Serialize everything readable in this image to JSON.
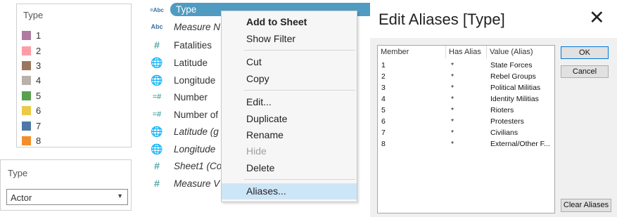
{
  "legend": {
    "title": "Type",
    "items": [
      {
        "label": "1",
        "color": "#b07aa1"
      },
      {
        "label": "2",
        "color": "#ff9da7"
      },
      {
        "label": "3",
        "color": "#9c755f"
      },
      {
        "label": "4",
        "color": "#bab0ac"
      },
      {
        "label": "5",
        "color": "#59a14f"
      },
      {
        "label": "6",
        "color": "#edc948"
      },
      {
        "label": "7",
        "color": "#4e79a7"
      },
      {
        "label": "8",
        "color": "#f28e2b"
      }
    ]
  },
  "filter": {
    "title": "Type",
    "selected": "Actor"
  },
  "data_pane": {
    "selected_field": {
      "icon": "=Abc",
      "name": "Type"
    },
    "fields": [
      {
        "icon": "Abc",
        "name": "Measure N",
        "italic": true
      },
      {
        "icon": "#",
        "name": "Fatalities",
        "italic": false
      },
      {
        "icon": "globe",
        "name": "Latitude",
        "italic": false
      },
      {
        "icon": "globe",
        "name": "Longitude",
        "italic": false
      },
      {
        "icon": "=#",
        "name": "Number",
        "italic": false
      },
      {
        "icon": "=#",
        "name": "Number of",
        "italic": false
      },
      {
        "icon": "globe",
        "name": "Latitude (g",
        "italic": true
      },
      {
        "icon": "globe",
        "name": "Longitude",
        "italic": true
      },
      {
        "icon": "#",
        "name": "Sheet1 (Co",
        "italic": true
      },
      {
        "icon": "#",
        "name": "Measure V",
        "italic": true
      }
    ]
  },
  "context_menu": {
    "items": [
      {
        "label": "Add to Sheet",
        "bold": true
      },
      {
        "label": "Show Filter"
      },
      {
        "label": "Cut"
      },
      {
        "label": "Copy"
      },
      {
        "label": "Edit..."
      },
      {
        "label": "Duplicate"
      },
      {
        "label": "Rename"
      },
      {
        "label": "Hide",
        "disabled": true
      },
      {
        "label": "Delete"
      },
      {
        "label": "Aliases...",
        "highlighted": true
      }
    ]
  },
  "dialog": {
    "title": "Edit Aliases [Type]",
    "close_symbol": "✕",
    "columns": [
      "Member",
      "Has Alias",
      "Value (Alias)"
    ],
    "rows": [
      {
        "member": "1",
        "has_alias": "*",
        "value": "State Forces"
      },
      {
        "member": "2",
        "has_alias": "*",
        "value": "Rebel Groups"
      },
      {
        "member": "3",
        "has_alias": "*",
        "value": "Political Militias"
      },
      {
        "member": "4",
        "has_alias": "*",
        "value": "Identity Militias"
      },
      {
        "member": "5",
        "has_alias": "*",
        "value": "Rioters"
      },
      {
        "member": "6",
        "has_alias": "*",
        "value": "Protesters"
      },
      {
        "member": "7",
        "has_alias": "*",
        "value": "Civilians"
      },
      {
        "member": "8",
        "has_alias": "*",
        "value": "External/Other F..."
      }
    ],
    "ok_label": "OK",
    "cancel_label": "Cancel",
    "clear_label": "Clear Aliases"
  }
}
